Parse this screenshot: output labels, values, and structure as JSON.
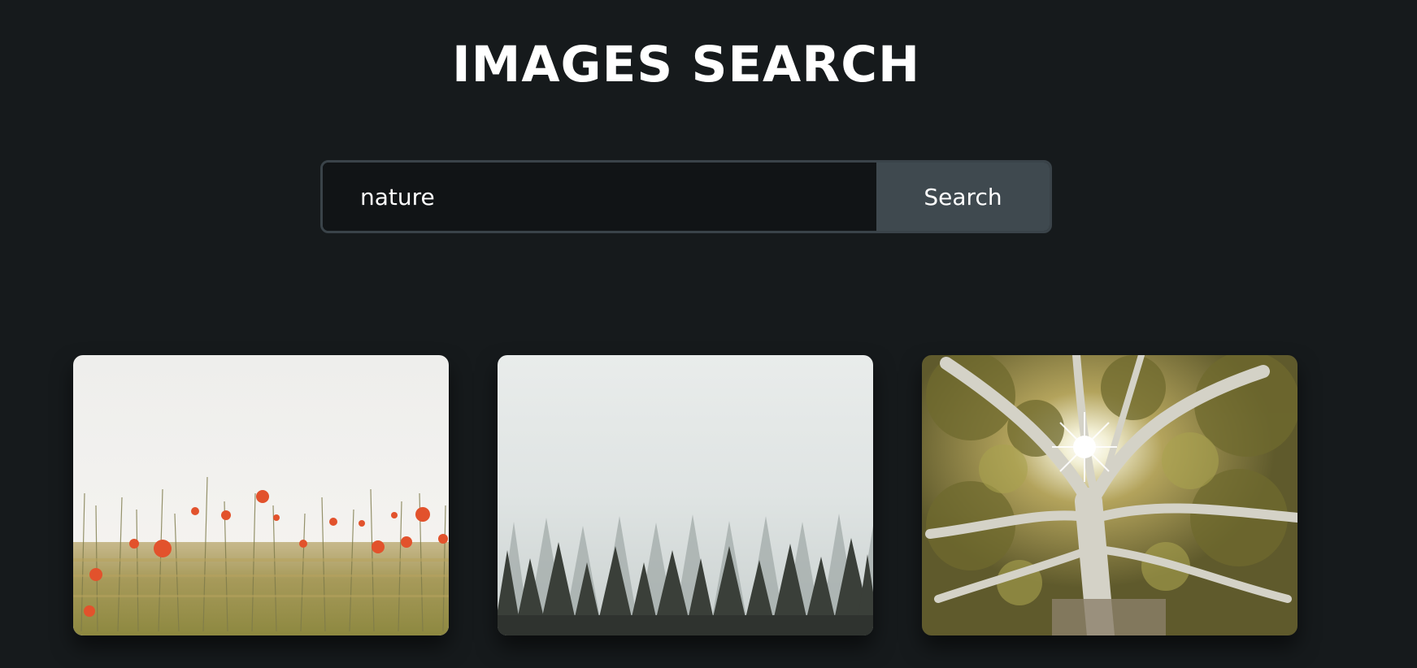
{
  "page": {
    "title": "IMAGES SEARCH"
  },
  "search": {
    "value": "nature",
    "button_label": "Search"
  },
  "results": [
    {
      "subject": "poppy-field"
    },
    {
      "subject": "foggy-forest"
    },
    {
      "subject": "sunlit-tree"
    }
  ],
  "colors": {
    "background": "#161a1c",
    "input_border": "#3a4349",
    "button_bg": "#3f494f",
    "text": "#ffffff"
  }
}
